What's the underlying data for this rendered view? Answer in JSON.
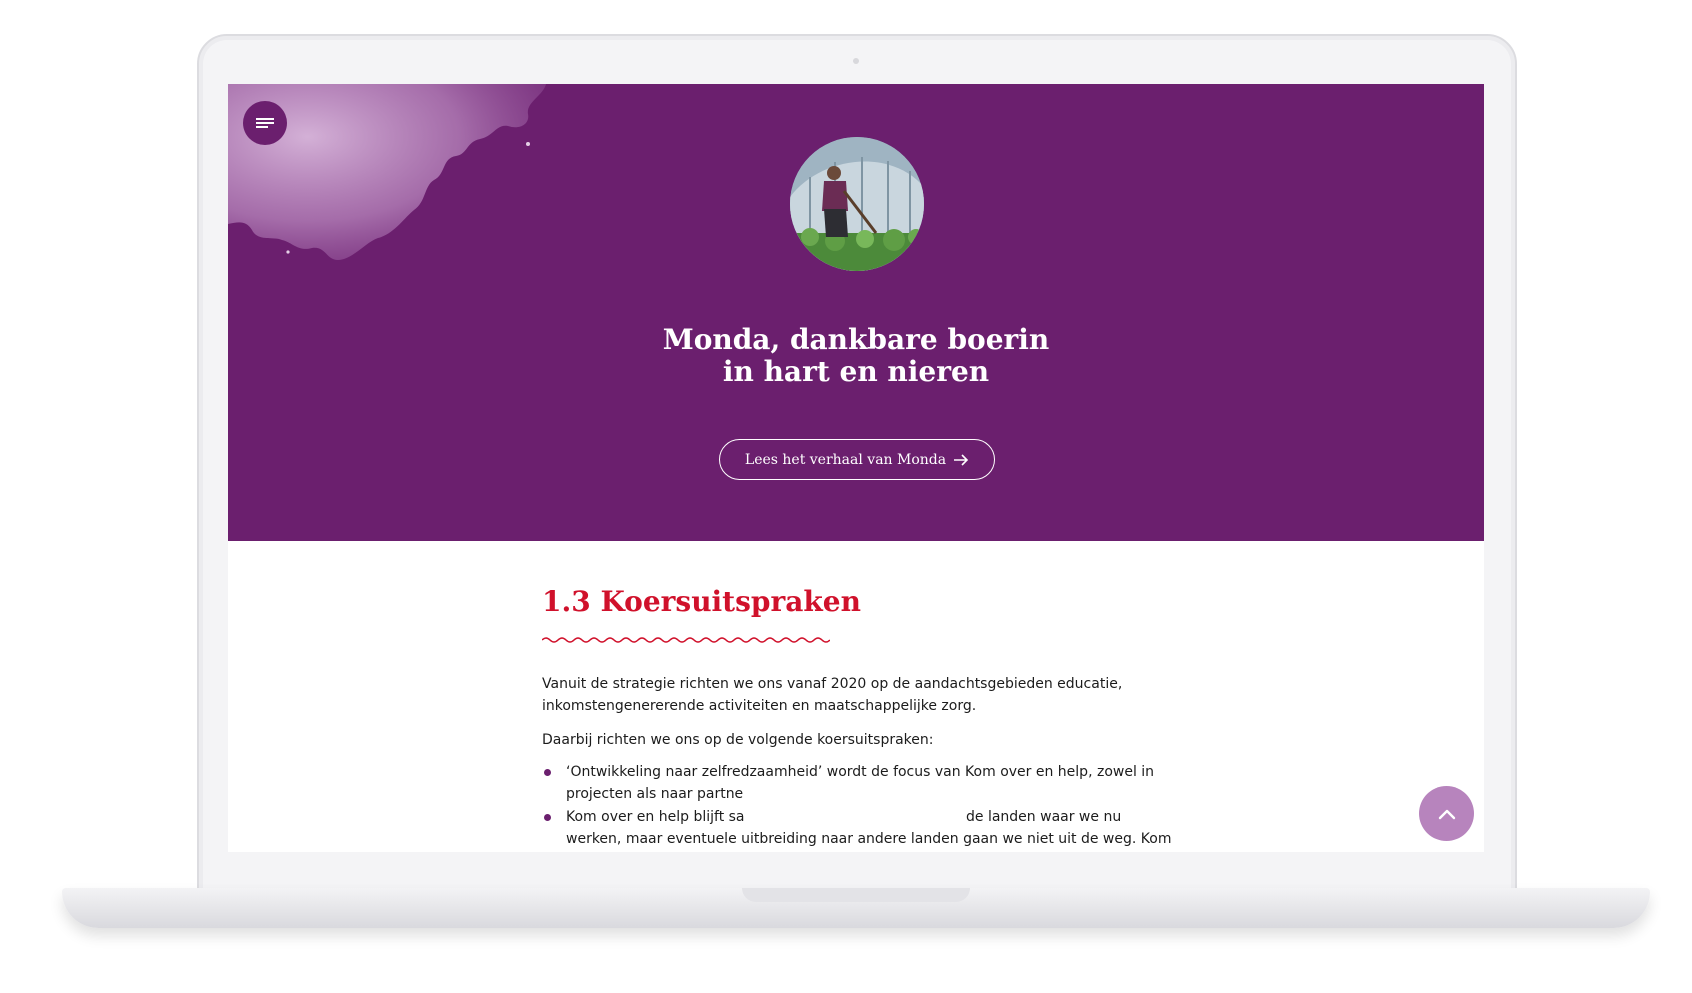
{
  "hero": {
    "title_line1": "Monda, dankbare boerin",
    "title_line2": "in hart en nieren",
    "cta_label": "Lees het verhaal van Monda",
    "background_color": "#6b1f6e"
  },
  "section": {
    "heading": "1.3 Koersuitspraken",
    "heading_color": "#d0112b",
    "intro_line1": "Vanuit de strategie richten we ons vanaf 2020 op de aandachtsgebieden educatie,",
    "intro_line2": "inkomstengenererende activiteiten en maatschappelijke zorg.",
    "lead": "Daarbij richten we ons op de volgende koersuitspraken:",
    "bullets": [
      {
        "line1": "‘Ontwikkeling naar zelfredzaamheid’ wordt de focus van Kom over en help, zowel in",
        "line2": "projecten als naar partne"
      },
      {
        "line1": "Kom over en help blijft sa",
        "line1_right": "de landen waar we nu",
        "line2": "werken, maar eventuele uitbreiding naar andere landen gaan we niet uit de weg. Kom"
      }
    ]
  },
  "icons": {
    "menu": "menu-lines-icon",
    "more": "more-vertical-icon",
    "prev": "chevron-left-icon",
    "grid": "grid-icon",
    "next": "chevron-right-icon",
    "scroll_top": "chevron-up-icon",
    "cta_arrow": "arrow-right-icon"
  }
}
